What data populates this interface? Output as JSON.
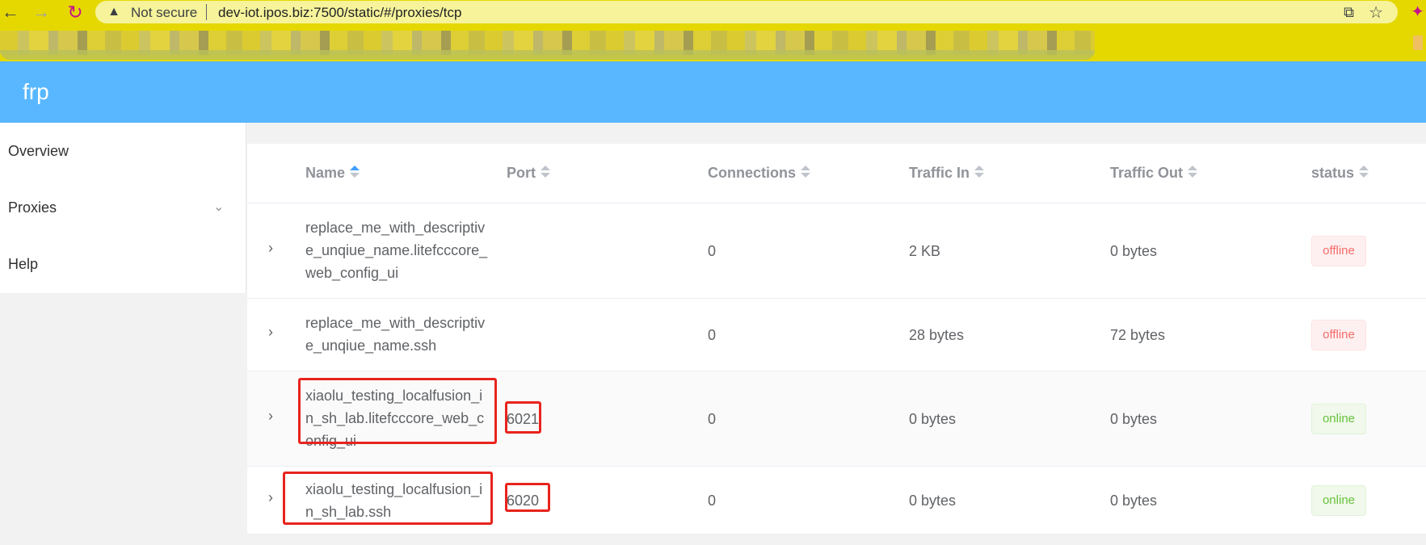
{
  "browser": {
    "not_secure": "Not secure",
    "url": "dev-iot.ipos.biz:7500/static/#/proxies/tcp"
  },
  "app": {
    "brand": "frp",
    "header_color": "#58b7ff"
  },
  "sidebar": {
    "items": [
      {
        "label": "Overview"
      },
      {
        "label": "Proxies"
      },
      {
        "label": "Help"
      }
    ]
  },
  "table": {
    "columns": [
      "Name",
      "Port",
      "Connections",
      "Traffic In",
      "Traffic Out",
      "status"
    ],
    "sorted_column": "Name",
    "rows": [
      {
        "name": "replace_me_with_descriptive_unqiue_name.litefcccore_web_config_ui",
        "port": "",
        "connections": "0",
        "traffic_in": "2 KB",
        "traffic_out": "0 bytes",
        "status": "offline"
      },
      {
        "name": "replace_me_with_descriptive_unqiue_name.ssh",
        "port": "",
        "connections": "0",
        "traffic_in": "28 bytes",
        "traffic_out": "72 bytes",
        "status": "offline"
      },
      {
        "name": "xiaolu_testing_localfusion_in_sh_lab.litefcccore_web_config_ui",
        "port": "6021",
        "connections": "0",
        "traffic_in": "0 bytes",
        "traffic_out": "0 bytes",
        "status": "online"
      },
      {
        "name": "xiaolu_testing_localfusion_in_sh_lab.ssh",
        "port": "6020",
        "connections": "0",
        "traffic_in": "0 bytes",
        "traffic_out": "0 bytes",
        "status": "online"
      }
    ]
  },
  "colors": {
    "offline": "#f56c6c",
    "online": "#67c23a",
    "highlight": "#e8231d"
  }
}
